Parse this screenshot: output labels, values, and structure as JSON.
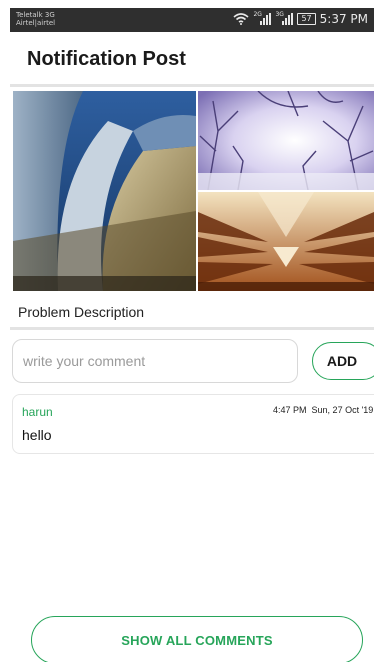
{
  "status_bar": {
    "carrier_line1": "Teletalk 3G",
    "carrier_line2": "Airtel|airtel",
    "sim1_tag": "2G",
    "sim2_tag": "3G",
    "battery": "57",
    "time": "5:37 PM",
    "icons": [
      "wifi-icon",
      "signal-icon",
      "signal-icon",
      "battery-icon"
    ]
  },
  "header": {
    "title": "Notification Post"
  },
  "images": [
    "architecture-photo",
    "snowy-trees-photo",
    "building-interior-photo"
  ],
  "post": {
    "description": "Problem Description"
  },
  "comment_form": {
    "placeholder": "write your comment",
    "value": "",
    "add_label": "ADD"
  },
  "comments": [
    {
      "author": "harun",
      "time": "4:47 PM",
      "date": "Sun, 27 Oct '19",
      "text": "hello"
    }
  ],
  "footer": {
    "show_all_label": "SHOW ALL COMMENTS"
  },
  "colors": {
    "accent": "#27a55a",
    "status_bar": "#2f2f2f",
    "divider": "#e3e3e3"
  }
}
